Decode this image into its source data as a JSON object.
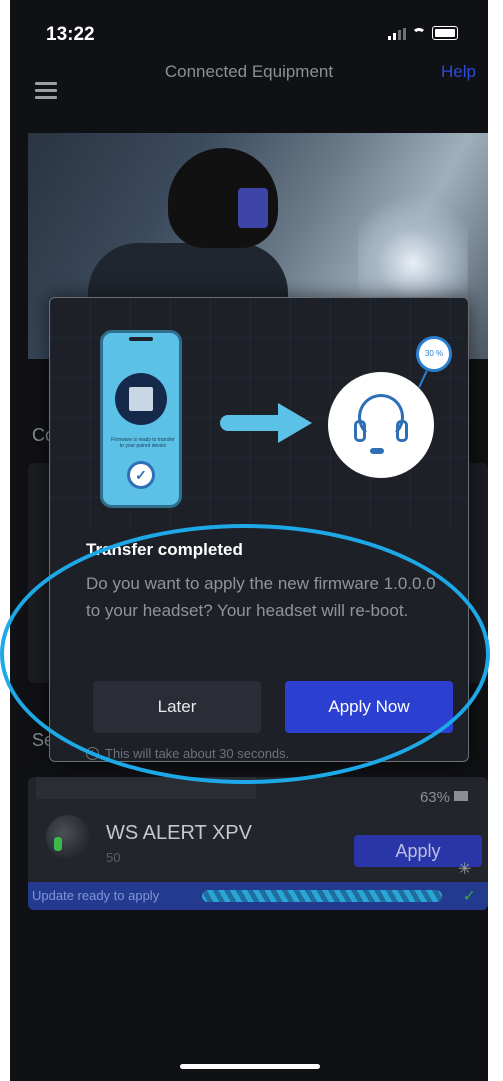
{
  "status_bar": {
    "time": "13:22"
  },
  "nav": {
    "title": "Connected Equipment",
    "help": "Help"
  },
  "background": {
    "section_label_1": "Co",
    "section_label_2": "Se",
    "device": {
      "name": "WS ALERT XPV",
      "number": "50",
      "percent": "63%",
      "apply_label": "Apply",
      "ready_text": "Update ready to apply",
      "ready_progress_fraction": 0.9
    }
  },
  "modal": {
    "phone_caption": "Firmware is ready to transfer to your paired device",
    "progress_badge": "30 %",
    "title": "Transfer completed",
    "body": "Do you want to apply the new firmware 1.0.0.0 to your headset? Your headset will re-boot.",
    "later_label": "Later",
    "apply_now_label": "Apply Now",
    "hint": "This will take about 30 seconds."
  },
  "colors": {
    "accent": "#2b3fd1",
    "highlight": "#1da9e8",
    "illustration": "#5cc1e6"
  },
  "icons": [
    "menu-icon",
    "signal-icon",
    "wifi-icon",
    "battery-icon",
    "chip-icon",
    "check-icon",
    "arrow-right-icon",
    "headset-icon",
    "clock-icon",
    "spinner-icon"
  ]
}
